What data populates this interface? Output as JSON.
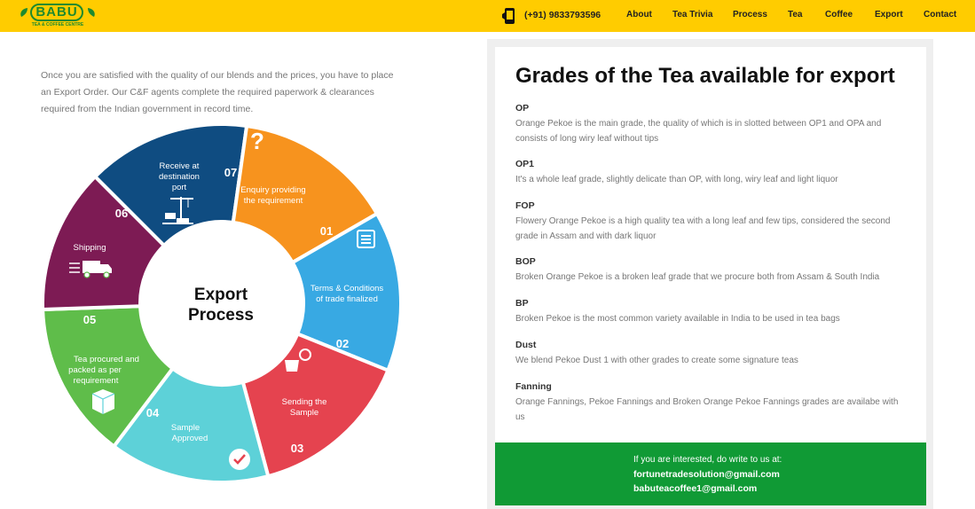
{
  "brand": {
    "name": "BABU",
    "subtitle": "TEA & COFFEE CENTRE",
    "colors": {
      "primary_green": "#1e8a2e",
      "header_yellow": "#ffcc00"
    }
  },
  "header": {
    "phone": "(+91) 9833793596",
    "nav": [
      "About",
      "Tea Trivia",
      "Process",
      "Tea",
      "Coffee",
      "Export",
      "Contact"
    ]
  },
  "intro": "Once you are satisfied with the quality of our blends and the prices, you have to place an Export Order. Our C&F agents complete the required paperwork & clearances required from the Indian government in record time.",
  "process": {
    "center_line1": "Export",
    "center_line2": "Process",
    "steps": [
      {
        "number": "01",
        "line1": "Enquiry providing",
        "line2": "the requirement",
        "line3": "",
        "icon": "question-mark-icon",
        "color": "#0f4c81"
      },
      {
        "number": "02",
        "line1": "Terms & Conditions",
        "line2": "of trade finalized",
        "line3": "",
        "icon": "document-icon",
        "color": "#f7931e"
      },
      {
        "number": "03",
        "line1": "Sending the",
        "line2": "Sample",
        "line3": "",
        "icon": "teapot-icon",
        "color": "#38a9e3"
      },
      {
        "number": "04",
        "line1": "Sample",
        "line2": "Approved",
        "line3": "",
        "icon": "checkmark-icon",
        "color": "#e5434f"
      },
      {
        "number": "05",
        "line1": "Tea procured and",
        "line2": "packed as per",
        "line3": "requirement",
        "icon": "box-icon",
        "color": "#5dd1d8"
      },
      {
        "number": "06",
        "line1": "Shipping",
        "line2": "",
        "line3": "",
        "icon": "truck-icon",
        "color": "#5fbd4a"
      },
      {
        "number": "07",
        "line1": "Receive at",
        "line2": "destination",
        "line3": "port",
        "icon": "crane-icon",
        "color": "#7d1b54"
      }
    ]
  },
  "grades": {
    "title": "Grades of the Tea available for export",
    "items": [
      {
        "name": "OP",
        "desc": "Orange Pekoe is the main grade, the quality of which is in slotted between OP1 and OPA and consists of long wiry leaf without tips"
      },
      {
        "name": "OP1",
        "desc": "It's a whole leaf grade, slightly delicate than OP, with long, wiry leaf and light liquor"
      },
      {
        "name": "FOP",
        "desc": "Flowery Orange Pekoe is a high quality tea with a long leaf and few tips, considered the second grade in Assam and with dark liquor"
      },
      {
        "name": "BOP",
        "desc": "Broken Orange Pekoe is a broken leaf grade that we procure both from Assam & South India"
      },
      {
        "name": "BP",
        "desc": "Broken Pekoe is the most common variety available in India to be used in tea bags"
      },
      {
        "name": "Dust",
        "desc": "We blend Pekoe Dust 1 with other grades to create some signature teas"
      },
      {
        "name": "Fanning",
        "desc": "Orange Fannings, Pekoe Fannings and Broken Orange Pekoe Fannings grades are availabe with us"
      }
    ]
  },
  "contact": {
    "lead": "If you are interested, do write to us at:",
    "email1": "fortunetradesolution@gmail.com",
    "email2": "babuteacoffee1@gmail.com"
  }
}
